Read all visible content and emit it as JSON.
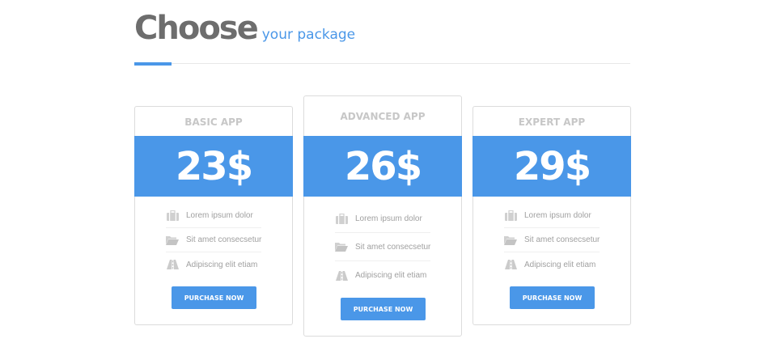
{
  "header": {
    "title": "Choose",
    "subtitle": "your package"
  },
  "colors": {
    "accent": "#4a97e8",
    "title": "#6d6d6d",
    "muted": "#c7c7c7"
  },
  "plans": [
    {
      "name": "BASIC APP",
      "price": "23$",
      "features": [
        {
          "icon": "briefcase-icon",
          "label": "Lorem ipsum dolor"
        },
        {
          "icon": "folder-open-icon",
          "label": "Sit amet consecsetur"
        },
        {
          "icon": "road-icon",
          "label": "Adipiscing elit etiam"
        }
      ],
      "button": "PURCHASE NOW"
    },
    {
      "name": "ADVANCED APP",
      "price": "26$",
      "features": [
        {
          "icon": "briefcase-icon",
          "label": "Lorem ipsum dolor"
        },
        {
          "icon": "folder-open-icon",
          "label": "Sit amet consecsetur"
        },
        {
          "icon": "road-icon",
          "label": "Adipiscing elit etiam"
        }
      ],
      "button": "PURCHASE NOW"
    },
    {
      "name": "EXPERT APP",
      "price": "29$",
      "features": [
        {
          "icon": "briefcase-icon",
          "label": "Lorem ipsum dolor"
        },
        {
          "icon": "folder-open-icon",
          "label": "Sit amet consecsetur"
        },
        {
          "icon": "road-icon",
          "label": "Adipiscing elit etiam"
        }
      ],
      "button": "PURCHASE NOW"
    }
  ]
}
